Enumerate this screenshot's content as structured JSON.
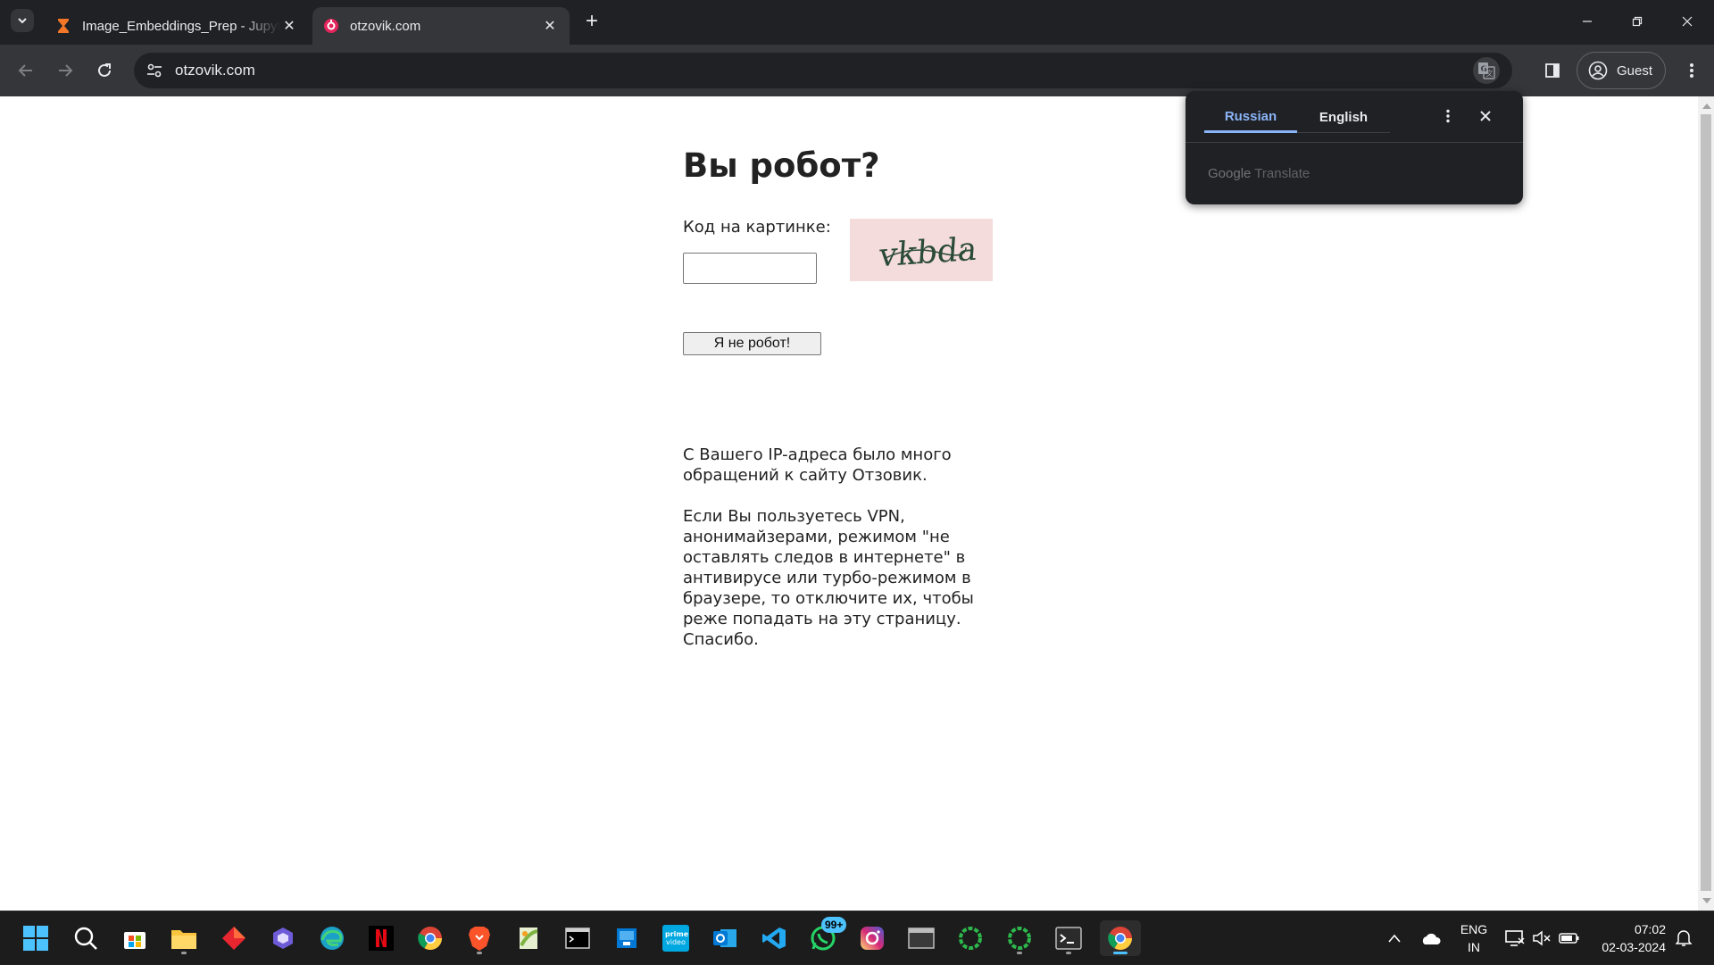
{
  "browser": {
    "tabs": [
      {
        "title": "Image_Embeddings_Prep - Jupyter",
        "active": false
      },
      {
        "title": "otzovik.com",
        "active": true
      }
    ],
    "url": "otzovik.com",
    "profile_label": "Guest"
  },
  "page": {
    "title": "Вы робот?",
    "code_label": "Код на картинке:",
    "captcha_text": "vkbda",
    "captcha_input_value": "",
    "submit_label": "Я не робот!",
    "notice_paragraph_1": "С Вашего IP-адреса было много\nобращений к сайту Отзовик.",
    "notice_paragraph_2": "Если Вы пользуетесь VPN,\nанонимайзерами, режимом \"не\nоставлять следов в интернете\" в\nантивирусе или турбо-режимом в\nбраузере, то отключите их, чтобы\nреже попадать на эту страницу.\nСпасибо."
  },
  "translate_popup": {
    "source_language": "Russian",
    "target_language": "English",
    "brand_google": "Google",
    "brand_translate": "Translate"
  },
  "taskbar": {
    "apps": [
      "start-icon",
      "search-icon",
      "store-icon",
      "file-explorer-icon",
      "app-red-icon",
      "copilot-icon",
      "edge-icon",
      "netflix-icon",
      "chrome-icon",
      "brave-icon",
      "notepad-plus-icon",
      "terminal-icon",
      "azure-icon",
      "prime-video-icon",
      "outlook-icon",
      "vscode-icon",
      "whatsapp-icon",
      "instagram-icon",
      "window-icon",
      "spinner-green-icon",
      "spinner-green-2-icon",
      "cmd-icon",
      "chrome-active-icon"
    ],
    "whatsapp_badge": "99+",
    "language_line_1": "ENG",
    "language_line_2": "IN",
    "time": "07:02",
    "date": "02-03-2024"
  },
  "colors": {
    "accent_blue": "#8ab4f8",
    "chrome_dark": "#202124",
    "toolbar": "#35363a",
    "captcha_bg": "#f5dcdc",
    "taskbar_accent": "#4cc2ff"
  }
}
